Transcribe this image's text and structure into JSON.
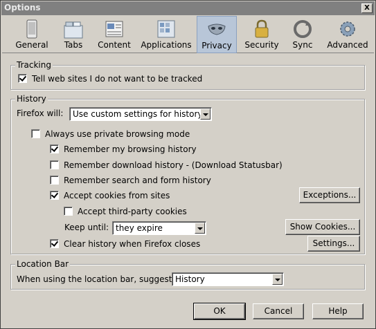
{
  "window": {
    "title": "Options",
    "close_label": "X"
  },
  "toolbar": {
    "panes": [
      {
        "label": "General",
        "icon": "general-icon"
      },
      {
        "label": "Tabs",
        "icon": "tabs-icon"
      },
      {
        "label": "Content",
        "icon": "content-icon"
      },
      {
        "label": "Applications",
        "icon": "applications-icon"
      },
      {
        "label": "Privacy",
        "icon": "privacy-icon",
        "selected": true
      },
      {
        "label": "Security",
        "icon": "security-icon"
      },
      {
        "label": "Sync",
        "icon": "sync-icon"
      },
      {
        "label": "Advanced",
        "icon": "advanced-icon"
      }
    ]
  },
  "tracking": {
    "legend": "Tracking",
    "do_not_track_label": "Tell web sites I do not want to be tracked",
    "do_not_track_checked": true
  },
  "history": {
    "legend": "History",
    "firefox_will_label": "Firefox will:",
    "firefox_will_value": "Use custom settings for history",
    "private_mode_label": "Always use private browsing mode",
    "private_mode_checked": false,
    "remember_browsing_label": "Remember my browsing history",
    "remember_browsing_checked": true,
    "remember_download_label": "Remember download history - (Download Statusbar)",
    "remember_download_checked": false,
    "remember_search_label": "Remember search and form history",
    "remember_search_checked": false,
    "accept_cookies_label": "Accept cookies from sites",
    "accept_cookies_checked": true,
    "exceptions_button": "Exceptions...",
    "third_party_label": "Accept third-party cookies",
    "third_party_checked": false,
    "keep_until_label": "Keep until:",
    "keep_until_value": "they expire",
    "show_cookies_button": "Show Cookies...",
    "clear_on_close_label": "Clear history when Firefox closes",
    "clear_on_close_checked": true,
    "settings_button": "Settings..."
  },
  "location_bar": {
    "legend": "Location Bar",
    "suggest_label": "When using the location bar, suggest:",
    "suggest_value": "History"
  },
  "buttons": {
    "ok": "OK",
    "cancel": "Cancel",
    "help": "Help"
  },
  "colors": {
    "dialog_bg": "#d4d0c8",
    "selected_pane_bg": "#b8c6d8",
    "titlebar_bg": "#808080"
  }
}
